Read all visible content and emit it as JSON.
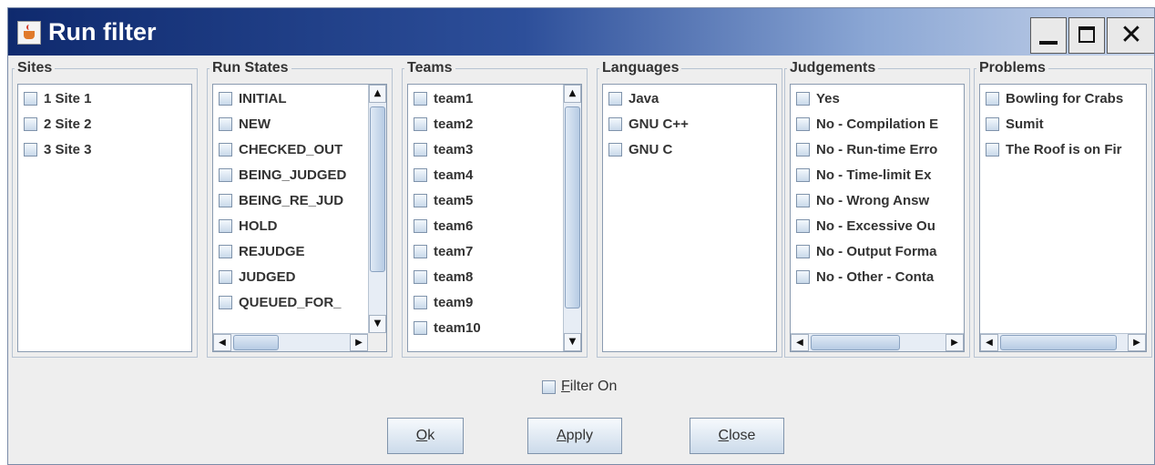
{
  "window": {
    "title": "Run filter",
    "app_icon": "java-cup-icon",
    "controls": [
      "minimize",
      "maximize",
      "close"
    ]
  },
  "sites": {
    "label": "Sites",
    "items": [
      "1 Site 1",
      "2 Site 2",
      "3 Site 3"
    ]
  },
  "run_states": {
    "label": "Run States",
    "items": [
      "INITIAL",
      "NEW",
      "CHECKED_OUT",
      "BEING_JUDGED",
      "BEING_RE_JUD",
      "HOLD",
      "REJUDGE",
      "JUDGED",
      "QUEUED_FOR_"
    ]
  },
  "teams": {
    "label": "Teams",
    "items": [
      "team1",
      "team2",
      "team3",
      "team4",
      "team5",
      "team6",
      "team7",
      "team8",
      "team9",
      "team10"
    ]
  },
  "languages": {
    "label": "Languages",
    "items": [
      "Java",
      "GNU C++",
      "GNU C"
    ]
  },
  "judgements": {
    "label": "Judgements",
    "items": [
      "Yes",
      "No - Compilation E",
      "No - Run-time Erro",
      "No - Time-limit Ex",
      "No - Wrong Answ",
      "No - Excessive Ou",
      "No - Output Forma",
      "No - Other - Conta"
    ]
  },
  "problems": {
    "label": "Problems",
    "items": [
      "Bowling for Crabs",
      "Sumit",
      "The Roof is on Fir"
    ]
  },
  "filter_on": {
    "mnemonic": "F",
    "rest": "ilter On",
    "checked": false
  },
  "buttons": {
    "ok": {
      "mnemonic": "O",
      "rest": "k"
    },
    "apply": {
      "mnemonic": "A",
      "rest": "pply"
    },
    "close": {
      "mnemonic": "C",
      "rest": "lose"
    }
  }
}
